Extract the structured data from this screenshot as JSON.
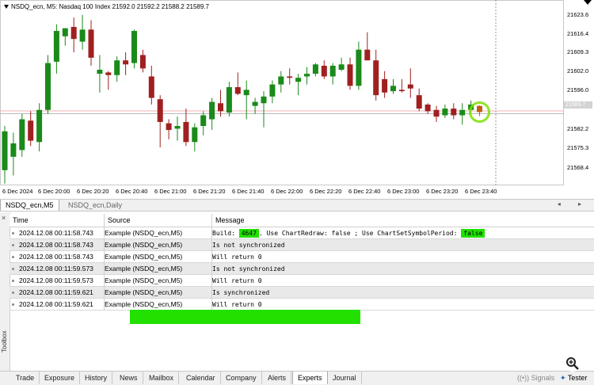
{
  "chart": {
    "title_prefix": "NSDQ_ecn, M5:",
    "title_rest": "Nasdaq 100 Index   21592.0 21592.2 21588.2 21589.7",
    "current_price_tag": "21589.7",
    "price_labels": [
      "21623.6",
      "21616.4",
      "21609.3",
      "21602.0",
      "21596.0",
      "21589.7",
      "21582.2",
      "21575.3",
      "21568.4"
    ],
    "time_labels": [
      "6 Dec 2024",
      "6 Dec 20:00",
      "6 Dec 20:20",
      "6 Dec 20:40",
      "6 Dec 21:00",
      "6 Dec 21:20",
      "6 Dec 21:40",
      "6 Dec 22:00",
      "6 Dec 22:20",
      "6 Dec 22:40",
      "6 Dec 23:00",
      "6 Dec 23:20",
      "6 Dec 23:40"
    ],
    "colors": {
      "bull": "#1a8a1a",
      "bear": "#a02020",
      "highlight_ring": "#7be000",
      "price_line": "#f4b0b0"
    }
  },
  "chart_data": {
    "type": "candlestick",
    "ylim": [
      21563.5,
      21628.0
    ],
    "candles": [
      {
        "o": 21568.0,
        "h": 21584.5,
        "l": 21563.0,
        "c": 21582.5
      },
      {
        "o": 21573.0,
        "h": 21582.0,
        "l": 21566.0,
        "c": 21578.0
      },
      {
        "o": 21575.5,
        "h": 21589.0,
        "l": 21573.0,
        "c": 21587.0
      },
      {
        "o": 21586.5,
        "h": 21590.0,
        "l": 21577.0,
        "c": 21579.0
      },
      {
        "o": 21578.5,
        "h": 21593.0,
        "l": 21575.0,
        "c": 21590.5
      },
      {
        "o": 21590.5,
        "h": 21611.0,
        "l": 21589.0,
        "c": 21608.0
      },
      {
        "o": 21608.5,
        "h": 21622.5,
        "l": 21604.0,
        "c": 21620.0
      },
      {
        "o": 21618.0,
        "h": 21621.0,
        "l": 21614.5,
        "c": 21621.0
      },
      {
        "o": 21621.5,
        "h": 21625.0,
        "l": 21612.0,
        "c": 21617.0
      },
      {
        "o": 21616.0,
        "h": 21626.0,
        "l": 21613.0,
        "c": 21620.5
      },
      {
        "o": 21620.5,
        "h": 21624.0,
        "l": 21607.0,
        "c": 21610.0
      },
      {
        "o": 21604.0,
        "h": 21611.0,
        "l": 21597.0,
        "c": 21605.5
      },
      {
        "o": 21604.5,
        "h": 21605.0,
        "l": 21598.0,
        "c": 21603.5
      },
      {
        "o": 21603.5,
        "h": 21610.5,
        "l": 21601.0,
        "c": 21609.0
      },
      {
        "o": 21609.0,
        "h": 21612.0,
        "l": 21603.5,
        "c": 21607.5
      },
      {
        "o": 21608.0,
        "h": 21620.5,
        "l": 21606.0,
        "c": 21620.0
      },
      {
        "o": 21611.0,
        "h": 21613.0,
        "l": 21604.5,
        "c": 21606.0
      },
      {
        "o": 21603.0,
        "h": 21607.0,
        "l": 21592.5,
        "c": 21595.0
      },
      {
        "o": 21594.5,
        "h": 21596.0,
        "l": 21576.5,
        "c": 21586.0
      },
      {
        "o": 21585.5,
        "h": 21587.0,
        "l": 21579.5,
        "c": 21583.0
      },
      {
        "o": 21583.5,
        "h": 21588.0,
        "l": 21579.0,
        "c": 21584.5
      },
      {
        "o": 21586.0,
        "h": 21591.0,
        "l": 21577.0,
        "c": 21578.5
      },
      {
        "o": 21578.5,
        "h": 21585.5,
        "l": 21575.0,
        "c": 21584.0
      },
      {
        "o": 21584.5,
        "h": 21590.0,
        "l": 21581.0,
        "c": 21588.5
      },
      {
        "o": 21587.0,
        "h": 21595.0,
        "l": 21583.0,
        "c": 21593.5
      },
      {
        "o": 21593.0,
        "h": 21598.0,
        "l": 21588.0,
        "c": 21590.0
      },
      {
        "o": 21589.5,
        "h": 21601.0,
        "l": 21588.0,
        "c": 21599.0
      },
      {
        "o": 21599.0,
        "h": 21604.5,
        "l": 21596.0,
        "c": 21596.5
      },
      {
        "o": 21596.0,
        "h": 21601.5,
        "l": 21587.0,
        "c": 21598.0
      },
      {
        "o": 21592.0,
        "h": 21595.0,
        "l": 21589.0,
        "c": 21593.5
      },
      {
        "o": 21593.0,
        "h": 21597.5,
        "l": 21584.0,
        "c": 21595.5
      },
      {
        "o": 21595.5,
        "h": 21601.5,
        "l": 21593.0,
        "c": 21600.0
      },
      {
        "o": 21600.0,
        "h": 21605.0,
        "l": 21597.0,
        "c": 21603.0
      },
      {
        "o": 21603.0,
        "h": 21606.0,
        "l": 21600.0,
        "c": 21602.5
      },
      {
        "o": 21601.0,
        "h": 21604.0,
        "l": 21596.0,
        "c": 21602.5
      },
      {
        "o": 21603.0,
        "h": 21606.5,
        "l": 21600.0,
        "c": 21604.0
      },
      {
        "o": 21604.0,
        "h": 21608.0,
        "l": 21603.0,
        "c": 21607.5
      },
      {
        "o": 21607.0,
        "h": 21609.0,
        "l": 21602.0,
        "c": 21603.0
      },
      {
        "o": 21603.0,
        "h": 21608.0,
        "l": 21600.0,
        "c": 21607.0
      },
      {
        "o": 21605.5,
        "h": 21610.0,
        "l": 21605.0,
        "c": 21607.5
      },
      {
        "o": 21607.5,
        "h": 21610.0,
        "l": 21598.0,
        "c": 21599.5
      },
      {
        "o": 21599.5,
        "h": 21616.0,
        "l": 21598.0,
        "c": 21613.0
      },
      {
        "o": 21613.0,
        "h": 21619.5,
        "l": 21611.0,
        "c": 21609.0
      },
      {
        "o": 21609.0,
        "h": 21613.0,
        "l": 21594.0,
        "c": 21596.0
      },
      {
        "o": 21602.0,
        "h": 21605.0,
        "l": 21595.0,
        "c": 21597.0
      },
      {
        "o": 21597.5,
        "h": 21602.0,
        "l": 21596.5,
        "c": 21599.5
      },
      {
        "o": 21598.0,
        "h": 21602.0,
        "l": 21597.0,
        "c": 21597.5
      },
      {
        "o": 21600.0,
        "h": 21606.0,
        "l": 21595.0,
        "c": 21598.5
      },
      {
        "o": 21596.0,
        "h": 21598.5,
        "l": 21590.0,
        "c": 21591.0
      },
      {
        "o": 21592.5,
        "h": 21593.0,
        "l": 21589.0,
        "c": 21590.0
      },
      {
        "o": 21590.5,
        "h": 21592.0,
        "l": 21586.0,
        "c": 21588.0
      },
      {
        "o": 21588.5,
        "h": 21592.5,
        "l": 21587.5,
        "c": 21591.0
      },
      {
        "o": 21591.0,
        "h": 21593.0,
        "l": 21587.0,
        "c": 21588.5
      },
      {
        "o": 21588.5,
        "h": 21593.0,
        "l": 21585.0,
        "c": 21590.5
      },
      {
        "o": 21590.5,
        "h": 21594.0,
        "l": 21589.0,
        "c": 21592.5
      },
      {
        "o": 21592.0,
        "h": 21592.2,
        "l": 21588.2,
        "c": 21589.7
      }
    ]
  },
  "chart_tabs": [
    {
      "label": "NSDQ_ecn,M5",
      "active": true
    },
    {
      "label": "NSDQ_ecn,Daily",
      "active": false
    }
  ],
  "log": {
    "headers": {
      "time": "Time",
      "source": "Source",
      "message": "Message"
    },
    "rows": [
      {
        "time": "2024.12.08 00:11:58.743",
        "source": "Example (NSDQ_ecn,M5)",
        "msg_parts": [
          {
            "t": "Build: ",
            "hl": false
          },
          {
            "t": "4647",
            "hl": true
          },
          {
            "t": ". Use ChartRedraw: false ; Use ChartSetSymbolPeriod: ",
            "hl": false
          },
          {
            "t": "false",
            "hl": true
          }
        ]
      },
      {
        "time": "2024.12.08 00:11:58.743",
        "source": "Example (NSDQ_ecn,M5)",
        "msg_parts": [
          {
            "t": "Is not synchronized",
            "hl": false
          }
        ]
      },
      {
        "time": "2024.12.08 00:11:58.743",
        "source": "Example (NSDQ_ecn,M5)",
        "msg_parts": [
          {
            "t": "Will return 0",
            "hl": false
          }
        ]
      },
      {
        "time": "2024.12.08 00:11:59.573",
        "source": "Example (NSDQ_ecn,M5)",
        "msg_parts": [
          {
            "t": "Is not synchronized",
            "hl": false
          }
        ]
      },
      {
        "time": "2024.12.08 00:11:59.573",
        "source": "Example (NSDQ_ecn,M5)",
        "msg_parts": [
          {
            "t": "Will return 0",
            "hl": false
          }
        ]
      },
      {
        "time": "2024.12.08 00:11:59.621",
        "source": "Example (NSDQ_ecn,M5)",
        "msg_parts": [
          {
            "t": "Is synchronized",
            "hl": false
          }
        ]
      },
      {
        "time": "2024.12.08 00:11:59.621",
        "source": "Example (NSDQ_ecn,M5)",
        "msg_parts": [
          {
            "t": "Will return 0",
            "hl": false
          }
        ]
      }
    ]
  },
  "toolbox": {
    "label": "Toolbox",
    "close": "×"
  },
  "bottom_tabs": [
    {
      "label": "Trade",
      "active": false
    },
    {
      "label": "Exposure",
      "active": false
    },
    {
      "label": "History",
      "active": false
    },
    {
      "label": "News",
      "active": false
    },
    {
      "label": "Mailbox",
      "active": false
    },
    {
      "label": "Calendar",
      "active": false
    },
    {
      "label": "Company",
      "active": false
    },
    {
      "label": "Alerts",
      "active": false
    },
    {
      "label": "Experts",
      "active": true
    },
    {
      "label": "Journal",
      "active": false
    }
  ],
  "status": {
    "signals": "Signals",
    "tester": "Tester"
  },
  "icons": {
    "zoom": "zoom-magnifier-icon",
    "signals": "signals-icon",
    "tester": "tester-icon",
    "dropdown": "dropdown-triangle-icon"
  }
}
